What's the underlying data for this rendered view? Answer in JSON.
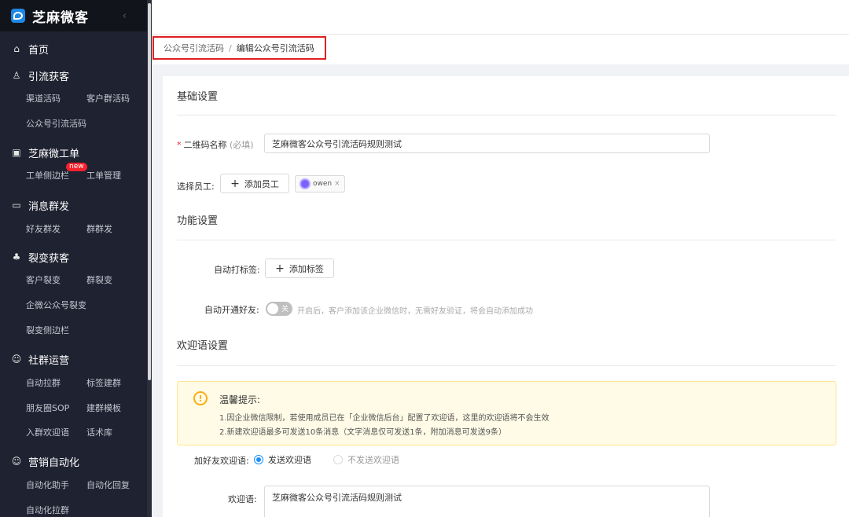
{
  "brand": {
    "name": "芝麻微客",
    "collapse_icon": "chevron-left-icon"
  },
  "sidebar": {
    "groups": [
      {
        "title": "首页",
        "icon": "home-icon",
        "items": []
      },
      {
        "title": "引流获客",
        "icon": "user-icon",
        "items": [
          "渠道活码",
          "客户群活码",
          "公众号引流活码"
        ]
      },
      {
        "title": "芝麻微工单",
        "icon": "ticket-icon",
        "items": [
          "工单侧边栏",
          "工单管理"
        ],
        "badge": "new"
      },
      {
        "title": "消息群发",
        "icon": "message-icon",
        "items": [
          "好友群发",
          "群群发"
        ]
      },
      {
        "title": "裂变获客",
        "icon": "share-icon",
        "items": [
          "客户裂变",
          "群裂变",
          "企微公众号裂变",
          "裂变侧边栏"
        ]
      },
      {
        "title": "社群运营",
        "icon": "community-icon",
        "items": [
          "自动拉群",
          "标签建群",
          "朋友圈SOP",
          "建群模板",
          "入群欢迎语",
          "话术库"
        ]
      },
      {
        "title": "营销自动化",
        "icon": "automation-icon",
        "items": [
          "自动化助手",
          "自动化回复",
          "自动化拉群"
        ]
      }
    ]
  },
  "breadcrumb": {
    "parent": "公众号引流活码",
    "separator": "/",
    "current": "编辑公众号引流活码"
  },
  "form": {
    "basic_title": "基础设置",
    "qr_name_label": "二维码名称",
    "qr_name_required": "*",
    "qr_name_hint": "(必填)",
    "qr_name_value": "芝麻微客公众号引流活码规则测试",
    "staff_label": "选择员工:",
    "add_staff_btn": "添加员工",
    "staff_tag": "owen",
    "func_title": "功能设置",
    "auto_tag_label": "自动打标签:",
    "add_tag_btn": "添加标签",
    "auto_friend_label": "自动开通好友:",
    "auto_friend_switch": "关",
    "auto_friend_desc": "开启后，客户添加该企业微信时，无需好友验证，将会自动添加成功",
    "welcome_title": "欢迎语设置",
    "alert_title": "温馨提示:",
    "alert_line1": "1.因企业微信限制，若使用成员已在「企业微信后台」配置了欢迎语，这里的欢迎语将不会生效",
    "alert_line2": "2.新建欢迎语最多可发送10条消息（文字消息仅可发送1条，附加消息可发送9条）",
    "friend_welcome_label": "加好友欢迎语:",
    "radio_send": "发送欢迎语",
    "radio_nosend": "不发送欢迎语",
    "welcome_label": "欢迎语:",
    "welcome_value": "芝麻微客公众号引流活码规则测试"
  }
}
